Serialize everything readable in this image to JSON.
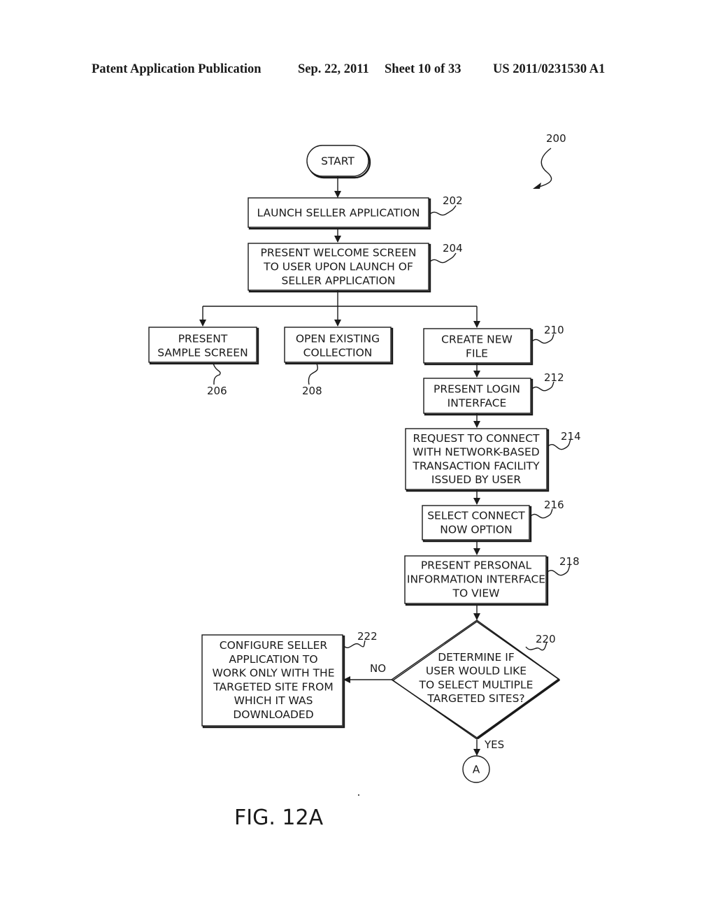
{
  "header": {
    "publication": "Patent Application Publication",
    "date": "Sep. 22, 2011",
    "sheet": "Sheet 10 of 33",
    "number": "US 2011/0231530 A1"
  },
  "figure": {
    "label": "FIG. 12A",
    "ref": "200"
  },
  "nodes": {
    "start": {
      "lines": [
        "START"
      ]
    },
    "n202": {
      "ref": "202",
      "lines": [
        "LAUNCH SELLER APPLICATION"
      ]
    },
    "n204": {
      "ref": "204",
      "lines": [
        "PRESENT WELCOME SCREEN",
        "TO USER UPON LAUNCH OF",
        "SELLER APPLICATION"
      ]
    },
    "n206": {
      "ref": "206",
      "lines": [
        "PRESENT",
        "SAMPLE SCREEN"
      ]
    },
    "n208": {
      "ref": "208",
      "lines": [
        "OPEN EXISTING",
        "COLLECTION"
      ]
    },
    "n210": {
      "ref": "210",
      "lines": [
        "CREATE NEW",
        "FILE"
      ]
    },
    "n212": {
      "ref": "212",
      "lines": [
        "PRESENT LOGIN",
        "INTERFACE"
      ]
    },
    "n214": {
      "ref": "214",
      "lines": [
        "REQUEST TO CONNECT",
        "WITH NETWORK-BASED",
        "TRANSACTION FACILITY",
        "ISSUED BY USER"
      ]
    },
    "n216": {
      "ref": "216",
      "lines": [
        "SELECT CONNECT",
        "NOW OPTION"
      ]
    },
    "n218": {
      "ref": "218",
      "lines": [
        "PRESENT PERSONAL",
        "INFORMATION INTERFACE",
        "TO VIEW"
      ]
    },
    "n220": {
      "ref": "220",
      "lines": [
        "DETERMINE IF",
        "USER WOULD LIKE",
        "TO SELECT MULTIPLE",
        "TARGETED SITES?"
      ]
    },
    "n222": {
      "ref": "222",
      "lines": [
        "CONFIGURE SELLER",
        "APPLICATION TO",
        "WORK ONLY WITH THE",
        "TARGETED SITE FROM",
        "WHICH IT WAS",
        "DOWNLOADED"
      ]
    },
    "connectorA": {
      "lines": [
        "A"
      ]
    }
  },
  "edges": {
    "no_label": "NO",
    "yes_label": "YES"
  }
}
